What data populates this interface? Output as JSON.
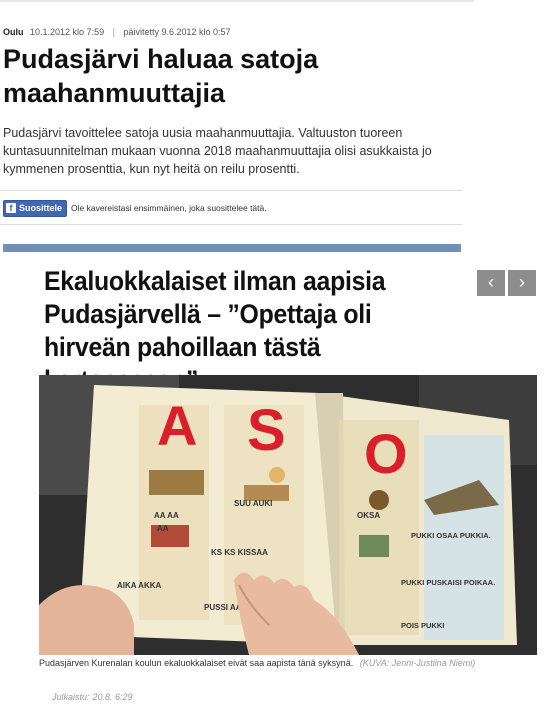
{
  "article": {
    "location": "Oulu",
    "date": "10.1.2012 klo 7:59",
    "updated": "päivitetty 9.6.2012 klo 0:57",
    "title": "Pudasjärvi haluaa satoja maahanmuuttajia",
    "lead": "Pudasjärvi tavoittelee satoja uusia maahanmuuttajia. Valtuuston tuoreen kuntasuunnitelman mukaan vuonna 2018 maahanmuuttajia olisi asukkaista jo kymmenen prosenttia, kun nyt heitä on reilu prosentti."
  },
  "facebook": {
    "button_label": "Suosittele",
    "text": "Ole kavereistasi ensimmäinen, joka suosittelee tätä."
  },
  "nav": {
    "prev": "‹",
    "next": "›"
  },
  "feature": {
    "headline": "Ekaluokkalaiset ilman aapisia Pudasjärvellä – ”Opettaja oli hirveän pahoillaan tästä kertoessaan”",
    "caption": "Pudasjärven Kurenalan koulun ekaluokkalaiset eivät saa aapista tänä syksynä.",
    "credit": "(KUVA: Jenni-Justiina Niemi)",
    "published_label": "Julkaistu:",
    "published_value": "20.8. 6:29"
  },
  "photo_content": {
    "letters": [
      "A",
      "S",
      "O"
    ],
    "words_left": [
      "AA AA",
      "AA",
      "AIKA AKKA"
    ],
    "words_mid": [
      "SUU AUKI",
      "KS KS KISSAA",
      "PUSSI AA"
    ],
    "words_right": [
      "OKSA",
      "PUKKI OSAA PUKKIA.",
      "PUKKI PUSKAISI POIKAA.",
      "POIS PUKKI"
    ]
  },
  "colors": {
    "accent_blue": "#6f8fb4",
    "facebook_blue": "#4267b2",
    "letter_red": "#d9202a"
  }
}
